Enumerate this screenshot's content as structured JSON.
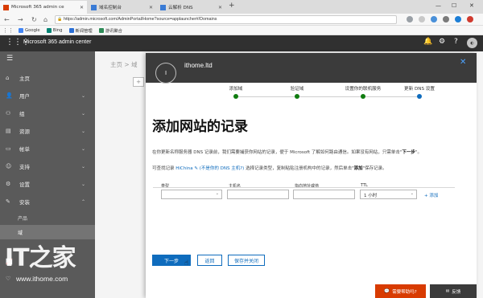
{
  "browser": {
    "tabs": [
      {
        "title": "Microsoft 365 admin ce",
        "active": true,
        "favicon_color": "#d83b01"
      },
      {
        "title": "域名控制台",
        "active": false,
        "favicon_color": "#3a7bd5"
      },
      {
        "title": "云解析 DNS",
        "active": false,
        "favicon_color": "#3a7bd5"
      }
    ],
    "tab_close": "✕",
    "new_tab": "+",
    "window_controls": [
      "—",
      "☐",
      "✕"
    ],
    "url": "https://admin.microsoft.com/AdminPortal/Home?source=applauncher#/Domains",
    "bookmarks": [
      {
        "label": "Google",
        "color": "#4285f4"
      },
      {
        "label": "Bing",
        "color": "#008373"
      },
      {
        "label": "新闻管理",
        "color": "#2a6fd6"
      },
      {
        "label": "游讯聚合",
        "color": "#2e8b57"
      }
    ]
  },
  "suite": {
    "app_title": "Microsoft 365 admin center",
    "bell": "🔔",
    "settings": "⚙",
    "help": "?"
  },
  "nav": {
    "items": [
      {
        "label": "主页",
        "icon": "⌂",
        "chev": ""
      },
      {
        "label": "用户",
        "icon": "👤",
        "chev": "⌄"
      },
      {
        "label": "组",
        "icon": "⚇",
        "chev": "⌄"
      },
      {
        "label": "资源",
        "icon": "▤",
        "chev": "⌄"
      },
      {
        "label": "帐单",
        "icon": "▭",
        "chev": "⌄"
      },
      {
        "label": "支持",
        "icon": "☺",
        "chev": "⌄"
      },
      {
        "label": "设置",
        "icon": "⚙",
        "chev": "⌄"
      },
      {
        "label": "安装",
        "icon": "✎",
        "chev": "⌃"
      }
    ],
    "sub_items": [
      {
        "label": "产品",
        "selected": false
      },
      {
        "label": "域",
        "selected": true
      }
    ]
  },
  "backdrop": {
    "breadcrumb": "主页 > 域",
    "add_symbol": "+"
  },
  "panel": {
    "domain_initial": "I",
    "domain": "ithome.ltd",
    "close": "✕",
    "steps": [
      {
        "label": "添加域",
        "status": "done",
        "color": "#107c10"
      },
      {
        "label": "验证域",
        "status": "done",
        "color": "#107c10"
      },
      {
        "label": "设置你的联机服务",
        "status": "done",
        "color": "#107c10"
      },
      {
        "label": "更新 DNS 设置",
        "status": "current",
        "color": "#0f6cbd"
      }
    ],
    "heading": "添加网站的记录",
    "para1_a": "在你更新名称服务器 DNS 记录前，我们需要捕获你网站的记录，便于 Microsoft 了解如何路由通信。如果没有网站，只需单击\"",
    "para1_b": "下一步",
    "para1_c": "\"。",
    "para2_a": "可查找记录",
    "para2_link1": "HiChina",
    "para2_link2": "(不是你的 DNS 主机?)",
    "para2_b": "选择记录类型，复制粘贴注册机构中的记录，然后单击\"",
    "para2_bold": "添加",
    "para2_c": "\"保存记录。",
    "fields": {
      "type_label": "类型",
      "host_label": "主机名",
      "target_label": "指向地址或值",
      "ttl_label": "TTL",
      "type_value": "",
      "host_value": "",
      "target_value": "",
      "ttl_value": "1 小时",
      "add": "+ 添加"
    },
    "buttons": {
      "next": "下一步",
      "back": "返回",
      "save_close": "保存并关闭"
    },
    "need_help": "需要帮助吗?",
    "feedback": "反馈"
  },
  "watermark": {
    "logo": "IT之家",
    "url": "www.ithome.com"
  }
}
